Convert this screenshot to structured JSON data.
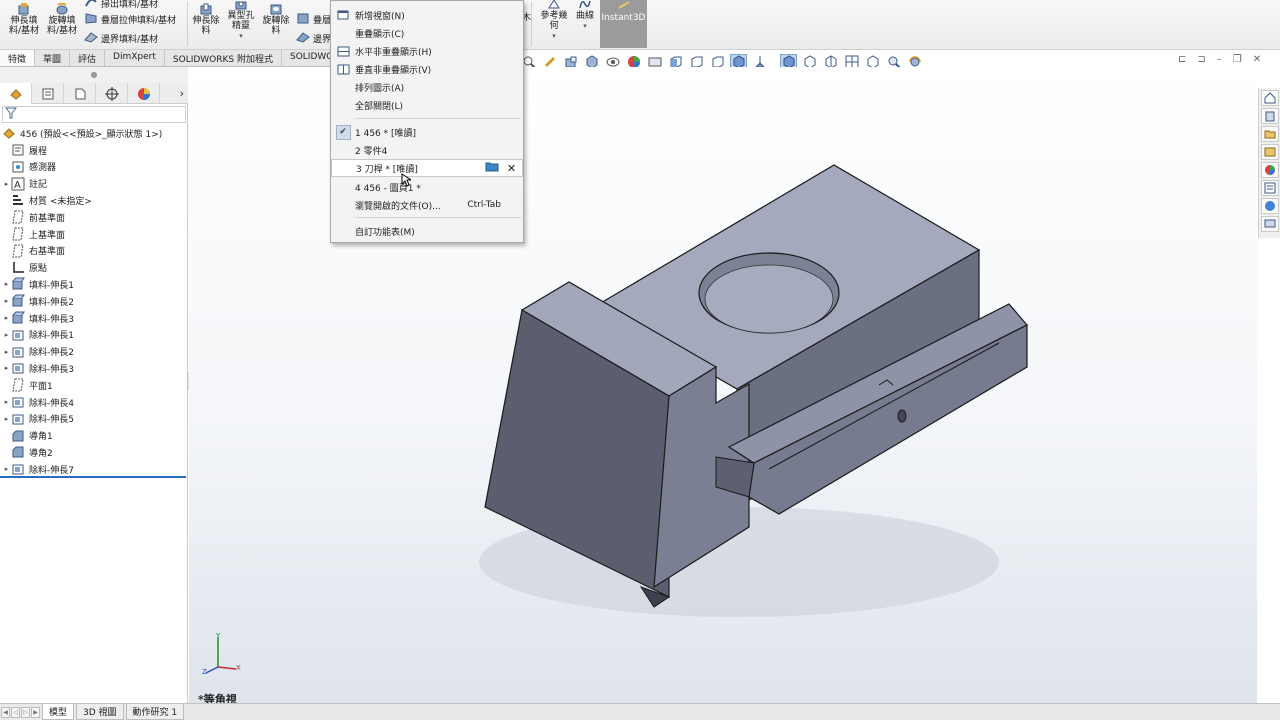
{
  "ribbon": {
    "btn_extrude_boss": "伸長填\n料/基材",
    "btn_revolve_boss": "旋轉填\n料/基材",
    "btn_sweep": "掃出填料/基材",
    "btn_loft": "疊層拉伸填料/基材",
    "btn_boundary": "邊界填料/基材",
    "btn_extrude_cut": "伸長除\n料",
    "btn_hole_wizard": "異型孔\n精靈",
    "btn_revolve_cut": "旋轉除\n料",
    "btn_loft_cut_partial": "疊層",
    "btn_boundary_cut_partial": "邊界",
    "btn_ref_geometry": "參考幾\n何",
    "btn_curves": "曲線",
    "btn_instant3d": "Instant3D"
  },
  "command_tabs": [
    "特徵",
    "草圖",
    "評估",
    "DimXpert",
    "SOLIDWORKS 附加程式",
    "SOLIDWO"
  ],
  "window_menu": {
    "new_window": "新增視窗(N)",
    "cascade": "重疊顯示(C)",
    "tile_horizontal": "水平非重疊顯示(H)",
    "tile_vertical": "垂直非重疊顯示(V)",
    "arrange_icons": "排列圖示(A)",
    "close_all": "全部關閉(L)",
    "doc1": "1 456 * [唯讀]",
    "doc2": "2 零件4",
    "doc3": "3 刀桿 * [唯讀]",
    "doc4": "4 456 - 圖頁1 *",
    "browse_recent": "瀏覽開啟的文件(O)...",
    "browse_recent_shortcut": "Ctrl-Tab",
    "customize": "自訂功能表(M)"
  },
  "tree": {
    "root": "456 (預設<<預設>_顯示狀態 1>)",
    "items": [
      {
        "label": "履程",
        "icon": "history-icon",
        "expander": ""
      },
      {
        "label": "感測器",
        "icon": "sensor-icon",
        "expander": ""
      },
      {
        "label": "註記",
        "icon": "annotation-icon",
        "expander": "▸"
      },
      {
        "label": "材質 <未指定>",
        "icon": "material-icon",
        "expander": ""
      },
      {
        "label": "前基準面",
        "icon": "plane-icon",
        "expander": ""
      },
      {
        "label": "上基準面",
        "icon": "plane-icon",
        "expander": ""
      },
      {
        "label": "右基準面",
        "icon": "plane-icon",
        "expander": ""
      },
      {
        "label": "原點",
        "icon": "origin-icon",
        "expander": ""
      },
      {
        "label": "填料-伸長1",
        "icon": "boss-extrude-icon",
        "expander": "▸"
      },
      {
        "label": "填料-伸長2",
        "icon": "boss-extrude-icon",
        "expander": "▸"
      },
      {
        "label": "填料-伸長3",
        "icon": "boss-extrude-icon",
        "expander": "▸"
      },
      {
        "label": "除料-伸長1",
        "icon": "cut-extrude-icon",
        "expander": "▸"
      },
      {
        "label": "除料-伸長2",
        "icon": "cut-extrude-icon",
        "expander": "▸"
      },
      {
        "label": "除料-伸長3",
        "icon": "cut-extrude-icon",
        "expander": "▸"
      },
      {
        "label": "平面1",
        "icon": "plane-icon",
        "expander": ""
      },
      {
        "label": "除料-伸長4",
        "icon": "cut-extrude-icon",
        "expander": "▸"
      },
      {
        "label": "除料-伸長5",
        "icon": "cut-extrude-icon",
        "expander": "▸"
      },
      {
        "label": "導角1",
        "icon": "chamfer-icon",
        "expander": ""
      },
      {
        "label": "導角2",
        "icon": "chamfer-icon",
        "expander": ""
      },
      {
        "label": "除料-伸長7",
        "icon": "cut-extrude-icon",
        "expander": "▸"
      }
    ]
  },
  "viewport": {
    "view_name": "*等角視",
    "triad": {
      "x": "X",
      "y": "Y",
      "z": "Z"
    }
  },
  "bottom_tabs": [
    "模型",
    "3D 視圖",
    "動作研究 1"
  ],
  "colors": {
    "accent": "#2a6bbf",
    "part_top": "#a6abc1",
    "part_side": "#6f7386",
    "part_dark": "#55586a",
    "instant3d_bg": "#9b9b9b"
  }
}
